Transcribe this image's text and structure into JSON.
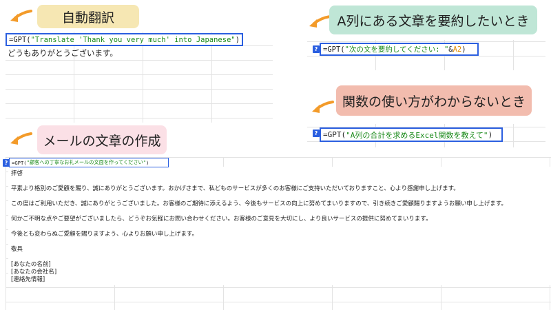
{
  "labels": {
    "translate": "自動翻訳",
    "summarize": "A列にある文章を要約したいとき",
    "howto": "関数の使い方がわからないとき",
    "email": "メールの文章の作成"
  },
  "translate": {
    "formula_open": "=GPT(",
    "formula_string": "\"Translate 'Thank you very much' into Japanese\"",
    "formula_close": ")",
    "result": "どうもありがとうございます。"
  },
  "summarize": {
    "formula_open": "=GPT(",
    "formula_string": "\"次の文を要約してください: \"",
    "formula_amp": " & ",
    "formula_ref": "A2",
    "formula_close": ")"
  },
  "howto": {
    "formula_open": "=GPT(",
    "formula_string": "\"A列の合計を求めるExcel関数を教えて\"",
    "formula_close": ")"
  },
  "email": {
    "formula_open": "=GPT(",
    "formula_string": "\"顧客への丁寧なお礼メールの文面を作ってください\"",
    "formula_close": ")",
    "lines": {
      "greeting": "拝啓",
      "p1": "平素より格別のご愛顧を賜り、誠にありがとうございます。おかげさまで、私どものサービスが多くのお客様にご支持いただいておりますこと、心より感謝申し上げます。",
      "p2": "この度はご利用いただき、誠にありがとうございました。お客様のご期待に添えるよう、今後もサービスの向上に努めてまいりますので、引き続きご愛顧賜りますようお願い申し上げます。",
      "p3": "何かご不明な点やご要望がございましたら、どうぞお気軽にお問い合わせください。お客様のご意見を大切にし、より良いサービスの提供に努めてまいります。",
      "p4": "今後とも変わらぬご愛顧を賜りますよう、心よりお願い申し上げます。",
      "closing": "敬具",
      "name": "[あなたの名前]",
      "company": "[あなたの会社名]",
      "contact": "[連絡先情報]"
    }
  },
  "icon_text": "?",
  "colors": {
    "label_yellow": "#f6e7b3",
    "label_green": "#bfe6d6",
    "label_salmon": "#f2bcae",
    "label_pink": "#fbe0e6",
    "arrow_orange": "#f39b2a",
    "formula_border": "#2b5fe0",
    "string_green": "#1a8a1a",
    "ref_orange": "#e08a00"
  }
}
